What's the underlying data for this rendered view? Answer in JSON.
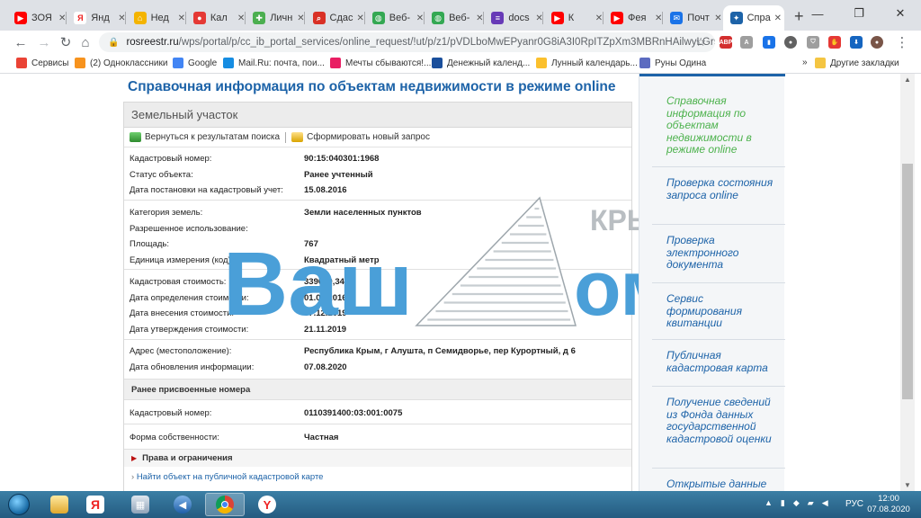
{
  "browser": {
    "tabs": [
      {
        "icon": "youtube-favicon",
        "color": "#ff0000",
        "glyph": "▶",
        "label": "ЗОЯ"
      },
      {
        "icon": "yandex-favicon",
        "color": "#ffffff",
        "glyph": "Я",
        "label": "Янд"
      },
      {
        "icon": "home-favicon",
        "color": "#f4b400",
        "glyph": "⌂",
        "label": "Нед"
      },
      {
        "icon": "red-favicon",
        "color": "#e53935",
        "glyph": "●",
        "label": "Кал"
      },
      {
        "icon": "puzzle-favicon",
        "color": "#4caf50",
        "glyph": "✚",
        "label": "Личн"
      },
      {
        "icon": "search-favicon",
        "color": "#d93025",
        "glyph": "⌕",
        "label": "Сдас"
      },
      {
        "icon": "globe-favicon",
        "color": "#34a853",
        "glyph": "◍",
        "label": "Веб-"
      },
      {
        "icon": "globe-favicon",
        "color": "#34a853",
        "glyph": "◍",
        "label": "Веб-"
      },
      {
        "icon": "docs-favicon",
        "color": "#673ab7",
        "glyph": "≡",
        "label": "docs"
      },
      {
        "icon": "youtube-favicon",
        "color": "#ff0000",
        "glyph": "▶",
        "label": "К"
      },
      {
        "icon": "youtube-favicon",
        "color": "#ff0000",
        "glyph": "▶",
        "label": "Фея"
      },
      {
        "icon": "mail-favicon",
        "color": "#1a73e8",
        "glyph": "✉",
        "label": "Почт"
      },
      {
        "icon": "rosreestr-favicon",
        "color": "#1d63a8",
        "glyph": "✦",
        "label": "Спра"
      }
    ],
    "url_host": "rosreestr.ru",
    "url_path": "/wps/portal/p/cc_ib_portal_services/online_request/!ut/p/z1/pVDLboMwEPyanr0G8iA3I0RpITZpXm3MBRnHAilwyLGr9u9r...",
    "bookmarks": [
      {
        "label": "Сервисы",
        "color": "#ea4335"
      },
      {
        "label": "(2) Одноклассники",
        "color": "#f7931e"
      },
      {
        "label": "Google",
        "color": "#4285f4"
      },
      {
        "label": "Mail.Ru: почта, пои...",
        "color": "#168de2"
      },
      {
        "label": "Мечты сбываются!...",
        "color": "#e91e63"
      },
      {
        "label": "Денежный календ...",
        "color": "#1a4f9c"
      },
      {
        "label": "Лунный календарь...",
        "color": "#fbc02d"
      },
      {
        "label": "Руны Одина",
        "color": "#5c6bc0"
      }
    ],
    "other_bookmarks": "Другие закладки",
    "more_glyph": "»"
  },
  "page": {
    "title": "Справочная информация по объектам недвижимости в режиме online",
    "panel_title": "Земельный участок",
    "back_link": "Вернуться к результатам поиска",
    "new_request_link": "Сформировать новый запрос",
    "fields_group1": [
      {
        "label": "Кадастровый номер:",
        "value": "90:15:040301:1968"
      },
      {
        "label": "Статус объекта:",
        "value": "Ранее учтенный"
      },
      {
        "label": "Дата постановки на кадастровый учет:",
        "value": "15.08.2016"
      }
    ],
    "fields_group2": [
      {
        "label": "Категория земель:",
        "value": "Земли населенных пунктов"
      },
      {
        "label": "Разрешенное использование:",
        "value": ""
      },
      {
        "label": "Площадь:",
        "value": "767"
      },
      {
        "label": "Единица измерения (код):",
        "value": "Квадратный метр"
      }
    ],
    "fields_group3": [
      {
        "label": "Кадастровая стоимость:",
        "value": "339029,34"
      },
      {
        "label": "Дата определения стоимости:",
        "value": "01.09.2016"
      },
      {
        "label": "Дата внесения стоимости:",
        "value": "07.12.2019"
      },
      {
        "label": "Дата утверждения стоимости:",
        "value": "21.11.2019"
      }
    ],
    "fields_group4": [
      {
        "label": "Адрес (местоположение):",
        "value": "Республика Крым, г Алушта, п Семидворье, пер Курортный, д 6"
      },
      {
        "label": "Дата обновления информации:",
        "value": "07.08.2020"
      }
    ],
    "prev_numbers_title": "Ранее присвоенные номера",
    "prev_number": {
      "label": "Кадастровый номер:",
      "value": "0110391400:03:001:0075"
    },
    "ownership": {
      "label": "Форма собственности:",
      "value": "Частная"
    },
    "rights_title": "Права и ограничения",
    "map_link": "Найти объект на публичной кадастровой карте",
    "watermark": {
      "left": "Ваш",
      "right": "ом",
      "top": "КРЫМ",
      "color": "#4a9fd8"
    }
  },
  "sidebar": {
    "links": [
      {
        "label": "Справочная информация по объектам недвижимости в режиме online",
        "active": true
      },
      {
        "label": "Проверка состояния запроса online",
        "active": false
      },
      {
        "label": "Проверка электронного документа",
        "active": false
      },
      {
        "label": "Сервис формирования квитанции",
        "active": false
      },
      {
        "label": "Публичная кадастровая карта",
        "active": false
      },
      {
        "label": "Получение сведений из Фонда данных государственной кадастровой оценки",
        "active": false
      },
      {
        "label": "Открытые данные",
        "active": false
      }
    ]
  },
  "taskbar": {
    "language": "РУС",
    "time": "12:00",
    "date": "07.08.2020"
  }
}
